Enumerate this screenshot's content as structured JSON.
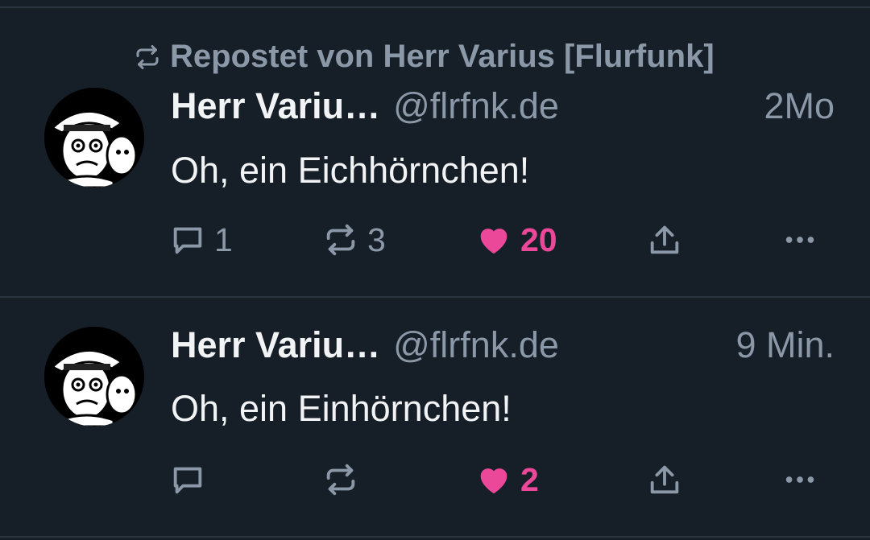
{
  "colors": {
    "background": "#161e27",
    "divider": "#2a3440",
    "text_primary": "#f1f3f5",
    "text_secondary": "#8b98a8",
    "like_accent": "#ec4899"
  },
  "posts": [
    {
      "repost_label": "Repostet von Herr Varius [Flurfunk]",
      "author_name": "Herr Variu…",
      "handle": "@flrfnk.de",
      "time": "2Mo",
      "text": "Oh, ein Eichhörnchen!",
      "avatar_icon": "comic-avatar",
      "replies": "1",
      "reposts": "3",
      "likes": "20",
      "liked": true
    },
    {
      "author_name": "Herr Variu…",
      "handle": "@flrfnk.de",
      "time": "9 Min.",
      "text": "Oh, ein Einhörnchen!",
      "avatar_icon": "comic-avatar",
      "replies": "",
      "reposts": "",
      "likes": "2",
      "liked": true
    }
  ],
  "icons": {
    "reply": "speech-bubble-icon",
    "repost": "repost-arrows-icon",
    "like": "heart-icon",
    "share": "share-upload-icon",
    "more": "more-dots-icon"
  }
}
